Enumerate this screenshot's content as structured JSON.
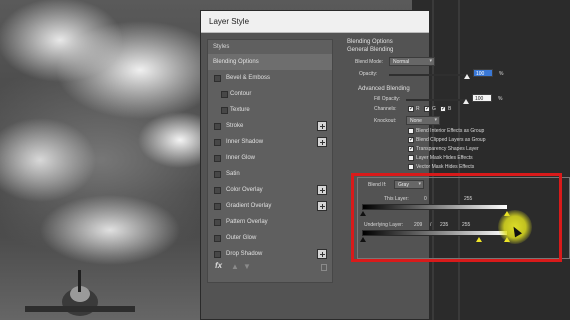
{
  "dialog": {
    "title": "Layer Style"
  },
  "styles_list": {
    "header": "Styles",
    "items": [
      {
        "label": "Blending Options",
        "selected": true
      },
      {
        "label": "Bevel & Emboss"
      },
      {
        "label": "Contour",
        "sub": true
      },
      {
        "label": "Texture",
        "sub": true
      },
      {
        "label": "Stroke",
        "plus": true
      },
      {
        "label": "Inner Shadow",
        "plus": true
      },
      {
        "label": "Inner Glow"
      },
      {
        "label": "Satin"
      },
      {
        "label": "Color Overlay",
        "plus": true
      },
      {
        "label": "Gradient Overlay",
        "plus": true
      },
      {
        "label": "Pattern Overlay"
      },
      {
        "label": "Outer Glow"
      },
      {
        "label": "Drop Shadow",
        "plus": true
      }
    ],
    "fx_label": "fx"
  },
  "blending_options": {
    "section_title": "Blending Options",
    "general": {
      "title": "General Blending",
      "blend_mode_label": "Blend Mode:",
      "blend_mode_value": "Normal",
      "opacity_label": "Opacity:",
      "opacity_value": "100",
      "opacity_unit": "%"
    },
    "advanced": {
      "title": "Advanced Blending",
      "fill_opacity_label": "Fill Opacity:",
      "fill_opacity_value": "100",
      "fill_unit": "%",
      "channels_label": "Channels:",
      "channels": [
        "R",
        "G",
        "B"
      ],
      "knockout_label": "Knockout:",
      "knockout_value": "None",
      "options": [
        {
          "label": "Blend Interior Effects as Group",
          "checked": false
        },
        {
          "label": "Blend Clipped Layers as Group",
          "checked": true
        },
        {
          "label": "Transparency Shapes Layer",
          "checked": true
        },
        {
          "label": "Layer Mask Hides Effects",
          "checked": false
        },
        {
          "label": "Vector Mask Hides Effects",
          "checked": false
        }
      ]
    },
    "blend_if": {
      "label": "Blend If:",
      "value": "Gray",
      "this_layer_label": "This Layer:",
      "this_layer_low": "0",
      "this_layer_high": "255",
      "underlying_label": "Underlying Layer:",
      "underlying_low": "209",
      "underlying_sep": "/",
      "underlying_mid": "235",
      "underlying_high": "255"
    }
  },
  "colors": {
    "highlight_box": "#d91a1a",
    "accent_blue": "#3a78d6"
  }
}
